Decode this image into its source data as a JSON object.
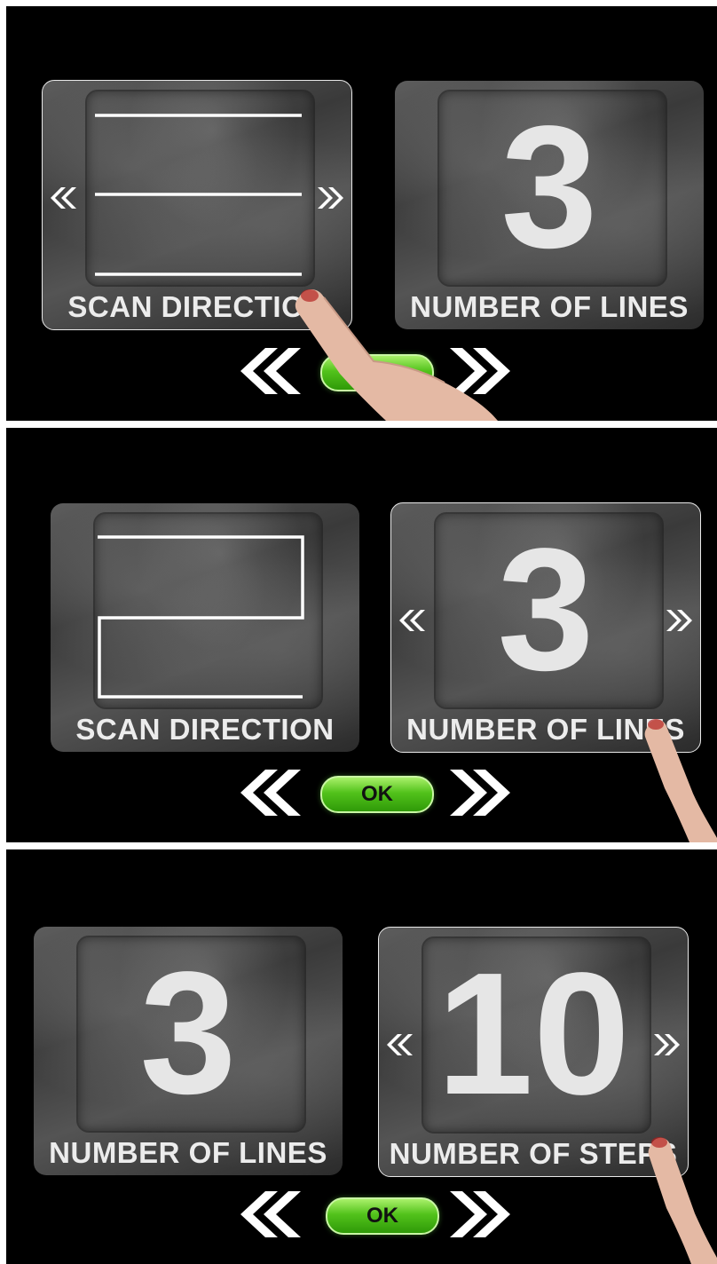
{
  "panels": [
    {
      "left": {
        "type": "scan",
        "pattern": "parallel",
        "label": "SCAN DIRECTION",
        "selected": true
      },
      "right": {
        "type": "number",
        "value": "3",
        "label": "NUMBER OF LINES",
        "selected": false
      },
      "ok_label": "OK"
    },
    {
      "left": {
        "type": "scan",
        "pattern": "zigzag",
        "label": "SCAN DIRECTION",
        "selected": false
      },
      "right": {
        "type": "number",
        "value": "3",
        "label": "NUMBER OF LINES",
        "selected": true
      },
      "ok_label": "OK"
    },
    {
      "left": {
        "type": "number",
        "value": "3",
        "label": "NUMBER OF LINES",
        "selected": false
      },
      "right": {
        "type": "number",
        "value": "10",
        "label": "NUMBER OF STEPS",
        "selected": true
      },
      "ok_label": "OK"
    }
  ],
  "icons": {
    "small_arrow_left": "double-chevron-left-icon",
    "small_arrow_right": "double-chevron-right-icon",
    "nav_prev": "double-chevron-left-icon",
    "nav_next": "double-chevron-right-icon",
    "pointer": "pointing-finger-icon"
  },
  "colors": {
    "background": "#000000",
    "ok_button": "#52c21b",
    "tile_text": "#ececec",
    "selected_border": "#e9e9e9"
  }
}
